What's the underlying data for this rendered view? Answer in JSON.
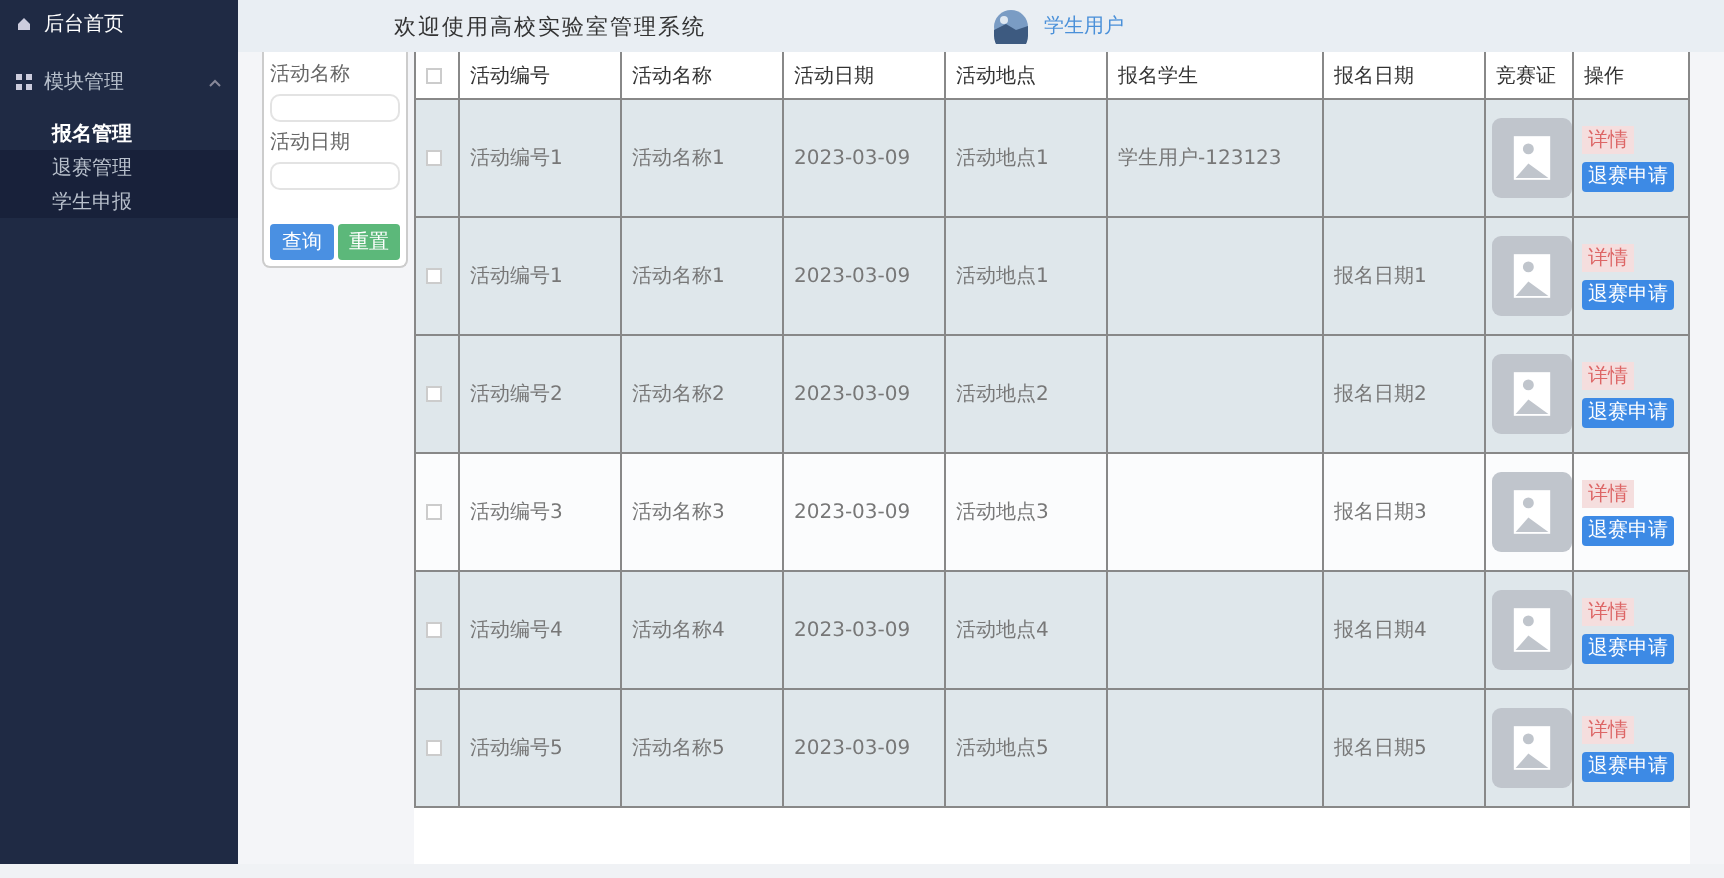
{
  "sidebar": {
    "items": [
      {
        "label": "后台首页"
      },
      {
        "label": "模块管理",
        "expanded": true,
        "children": [
          {
            "label": "报名管理",
            "selected": true
          },
          {
            "label": "退赛管理",
            "selected": false
          },
          {
            "label": "学生申报",
            "selected": false
          }
        ]
      }
    ]
  },
  "header": {
    "title": "欢迎使用高校实验室管理系统",
    "user": "学生用户"
  },
  "filter": {
    "fields": [
      {
        "label": "活动名称"
      },
      {
        "label": "活动日期"
      }
    ],
    "buttons": [
      {
        "label": "查询",
        "kind": "primary"
      },
      {
        "label": "重置",
        "kind": "success"
      }
    ]
  },
  "table": {
    "all_checked": false,
    "columns": [
      "活动编号",
      "活动名称",
      "活动日期",
      "活动地点",
      "报名学生",
      "报名日期",
      "竞赛证",
      "操作"
    ],
    "rows": [
      {
        "checked": false,
        "hovered": false,
        "cells": [
          "活动编号1",
          "活动名称1",
          "2023-03-09",
          "活动地点1",
          "学生用户-123123"
        ],
        "actions": [
          "详情",
          "退赛申请"
        ]
      },
      {
        "checked": false,
        "hovered": false,
        "cells": [
          "活动编号1",
          "活动名称1",
          "2023-03-09",
          "活动地点1",
          "",
          "报名日期1"
        ],
        "actions": [
          "详情",
          "退赛申请"
        ]
      },
      {
        "checked": false,
        "hovered": false,
        "cells": [
          "活动编号2",
          "活动名称2",
          "2023-03-09",
          "活动地点2",
          "",
          "报名日期2"
        ],
        "actions": [
          "详情",
          "退赛申请"
        ]
      },
      {
        "checked": false,
        "hovered": true,
        "cells": [
          "活动编号3",
          "活动名称3",
          "2023-03-09",
          "活动地点3",
          "",
          "报名日期3"
        ],
        "actions": [
          "详情",
          "退赛申请"
        ]
      },
      {
        "checked": false,
        "hovered": false,
        "cells": [
          "活动编号4",
          "活动名称4",
          "2023-03-09",
          "活动地点4",
          "",
          "报名日期4"
        ],
        "actions": [
          "详情",
          "退赛申请"
        ]
      },
      {
        "checked": false,
        "hovered": false,
        "cells": [
          "活动编号5",
          "活动名称5",
          "2023-03-09",
          "活动地点5",
          "",
          "报名日期5"
        ],
        "actions": [
          "详情",
          "退赛申请"
        ]
      }
    ]
  }
}
